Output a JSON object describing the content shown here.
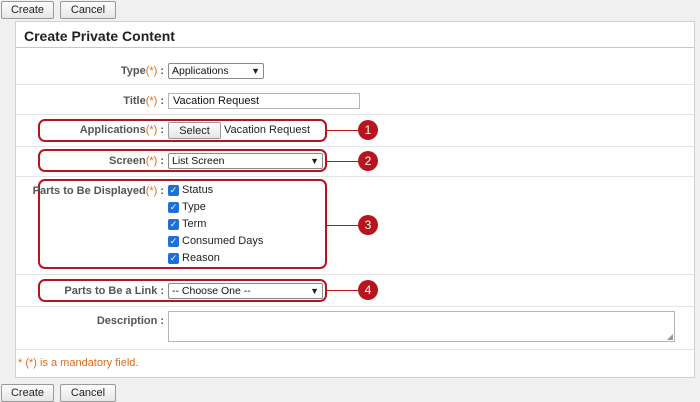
{
  "toolbar": {
    "create_label": "Create",
    "cancel_label": "Cancel"
  },
  "page_title": "Create Private Content",
  "required_mark": "(*)",
  "colon": ":",
  "fields": {
    "type": {
      "label": "Type",
      "value": "Applications"
    },
    "title": {
      "label": "Title",
      "value": "Vacation Request"
    },
    "applications": {
      "label": "Applications",
      "button": "Select",
      "value": "Vacation Request"
    },
    "screen": {
      "label": "Screen",
      "value": "List Screen"
    },
    "parts_displayed": {
      "label": "Parts to Be Displayed",
      "items": [
        {
          "label": "Status",
          "checked": true
        },
        {
          "label": "Type",
          "checked": true
        },
        {
          "label": "Term",
          "checked": true
        },
        {
          "label": "Consumed Days",
          "checked": true
        },
        {
          "label": "Reason",
          "checked": true
        }
      ]
    },
    "parts_link": {
      "label": "Parts to Be a Link",
      "value": "-- Choose One --"
    },
    "description": {
      "label": "Description",
      "value": ""
    }
  },
  "mandatory_note": "*  (*)  is a mandatory field.",
  "callouts": [
    "1",
    "2",
    "3",
    "4"
  ],
  "colors": {
    "callout": "#b8141e",
    "required": "#e06a1a",
    "checkbox": "#1e6fd9"
  }
}
